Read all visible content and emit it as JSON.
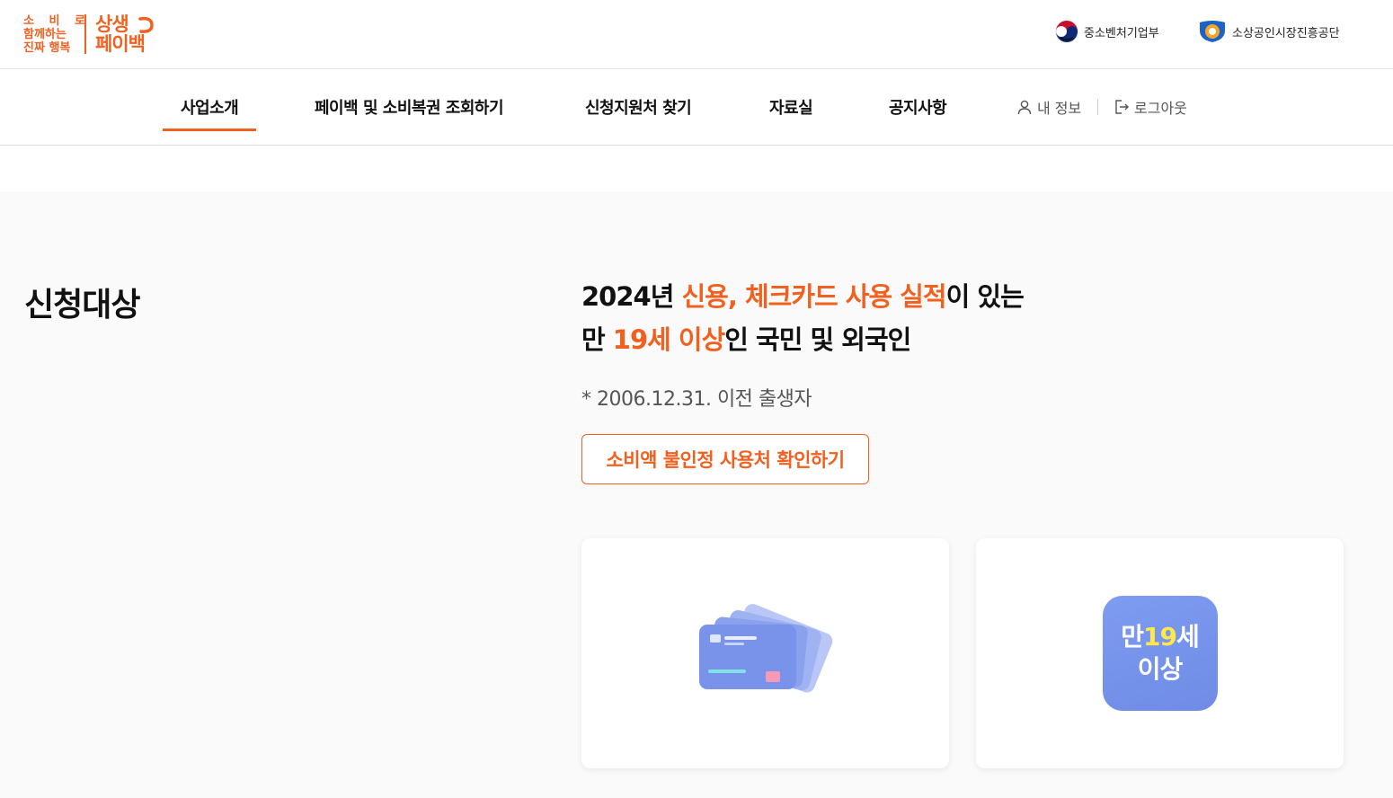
{
  "header": {
    "logo": {
      "slogan_line1": "소 비 로",
      "slogan_line2": "함께하는",
      "slogan_line3": "진짜 행복",
      "brand_line1": "상생",
      "brand_line2": "페이백"
    },
    "agencies": [
      {
        "label": "중소벤처기업부",
        "icon": "ministry-emblem-icon"
      },
      {
        "label": "소상공인시장진흥공단",
        "icon": "semas-logo-icon"
      }
    ]
  },
  "nav": {
    "items": [
      {
        "label": "사업소개",
        "active": true
      },
      {
        "label": "페이백 및 소비복권 조회하기",
        "active": false
      },
      {
        "label": "신청지원처 찾기",
        "active": false
      },
      {
        "label": "자료실",
        "active": false
      },
      {
        "label": "공지사항",
        "active": false
      }
    ],
    "utils": [
      {
        "label": "내 정보",
        "icon": "user-icon"
      },
      {
        "label": "로그아웃",
        "icon": "logout-icon"
      }
    ]
  },
  "main": {
    "section_title": "신청대상",
    "headline": {
      "l1_a": "2024년 ",
      "l1_b": "신용, 체크카드 사용 실적",
      "l1_c": "이 있는",
      "l2_a": "만 ",
      "l2_b": "19세 이상",
      "l2_c": "인 국민 및 외국인"
    },
    "note": "* 2006.12.31. 이전 출생자",
    "cta_label": "소비액 불인정 사용처 확인하기",
    "cards": [
      {
        "icon": "credit-cards-icon"
      },
      {
        "icon": "age-badge-icon",
        "badge_prefix": "만",
        "badge_num": "19",
        "badge_suffix": "세",
        "badge_line2": "이상"
      }
    ]
  },
  "colors": {
    "accent": "#f2601f",
    "background": "#fafafa",
    "badge_blue": "#7b96ee",
    "badge_yellow": "#ffe84a"
  }
}
